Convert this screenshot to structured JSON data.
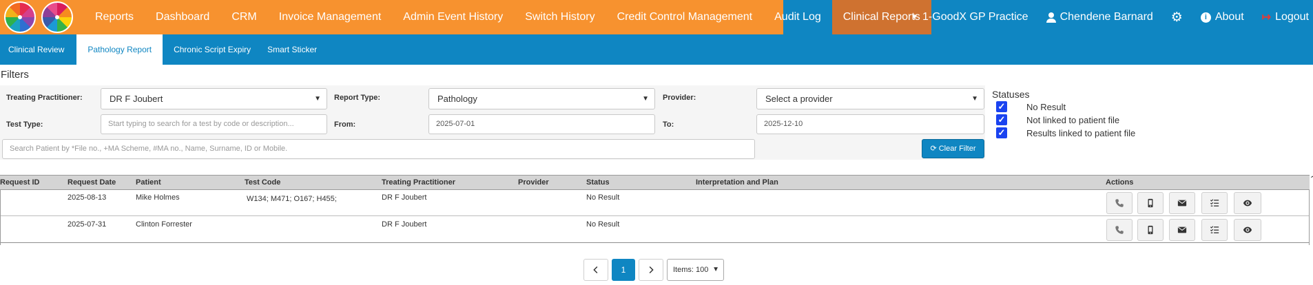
{
  "nav": {
    "items": [
      {
        "label": "Reports"
      },
      {
        "label": "Dashboard"
      },
      {
        "label": "CRM"
      },
      {
        "label": "Invoice Management"
      },
      {
        "label": "Admin Event History"
      },
      {
        "label": "Switch History"
      },
      {
        "label": "Credit Control Management"
      },
      {
        "label": "Audit Log"
      },
      {
        "label": "Clinical Reports"
      }
    ],
    "practice": "1-GoodX GP Practice",
    "user": "Chendene Barnard",
    "about": "About",
    "logout": "Logout"
  },
  "subnav": {
    "items": [
      {
        "label": "Clinical Review"
      },
      {
        "label": "Pathology Report"
      },
      {
        "label": "Chronic Script Expiry"
      },
      {
        "label": "Smart Sticker"
      }
    ]
  },
  "filters": {
    "title": "Filters",
    "treating_label": "Treating Practitioner:",
    "treating_value": "DR F Joubert",
    "report_type_label": "Report Type:",
    "report_type_value": "Pathology",
    "provider_label": "Provider:",
    "provider_value": "Select a provider",
    "test_type_label": "Test Type:",
    "test_type_placeholder": "Start typing to search for a test by code or description...",
    "from_label": "From:",
    "from_value": "2025-07-01",
    "to_label": "To:",
    "to_value": "2025-12-10",
    "search_placeholder": "Search Patient by *File no., +MA Scheme, #MA no., Name, Surname, ID or Mobile.",
    "clear_label": "Clear Filter"
  },
  "statuses": {
    "title": "Statuses",
    "items": [
      {
        "label": "No Result",
        "checked": true
      },
      {
        "label": "Not linked to patient file",
        "checked": true
      },
      {
        "label": "Results linked to patient file",
        "checked": true
      }
    ]
  },
  "table": {
    "headers": [
      "Request ID",
      "Request Date",
      "Patient",
      "Test Code",
      "Treating Practitioner",
      "Provider",
      "Status",
      "Interpretation and Plan",
      "Actions"
    ],
    "rows": [
      {
        "request_id": "",
        "request_date": "2025-08-13",
        "patient": "Mike Holmes",
        "test_code": "W134; M471; O167; H455;",
        "practitioner": "DR F Joubert",
        "provider": "",
        "status": "No Result",
        "interpretation": ""
      },
      {
        "request_id": "",
        "request_date": "2025-07-31",
        "patient": "Clinton Forrester",
        "test_code": "",
        "practitioner": "DR F Joubert",
        "provider": "",
        "status": "No Result",
        "interpretation": ""
      }
    ]
  },
  "pagination": {
    "current_page": "1",
    "items_label": "Items: 100"
  },
  "colors": {
    "primary_blue": "#0f86c2",
    "orange": "#f7922f",
    "active_orange": "#cf7230",
    "checkbox_blue": "#1a43f0",
    "logout_red": "#e53935"
  }
}
